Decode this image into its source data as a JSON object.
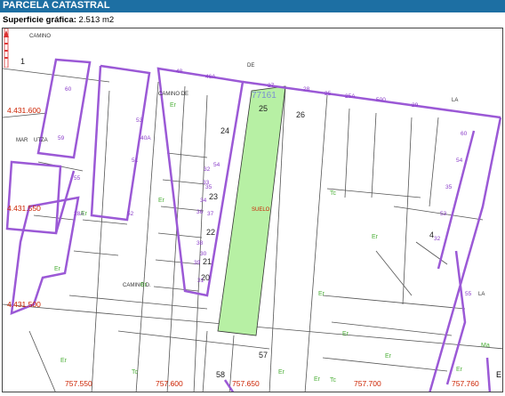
{
  "header": {
    "title": "PARCELA CATASTRAL"
  },
  "surface": {
    "label": "Superficie gráfica:",
    "value": "2.513 m2"
  },
  "map": {
    "highlight_color": "#b7f0a4",
    "parcel_border_color": "#9b59d6",
    "coord_color": "#cc2200",
    "parcel_ref": "77161",
    "parcel_number": "25",
    "parcel_class": "SUELO",
    "y_coords": [
      "4.431.600",
      "4.431.550",
      "4.431.500"
    ],
    "x_coords": [
      "757.550",
      "757.600",
      "757.650",
      "757.700",
      "757.760"
    ],
    "street_labels": [
      "CAMINO",
      "DE",
      "CAMINO DE",
      "CAMINO D.",
      "LA",
      "LA",
      "MAR",
      "UTZA",
      "E"
    ],
    "black_numbers": [
      "26",
      "24",
      "23",
      "22",
      "21",
      "20",
      "57",
      "58",
      "1",
      "4"
    ],
    "purple_numbers": [
      "48",
      "46A",
      "27",
      "28",
      "25",
      "25A",
      "500",
      "29",
      "60",
      "59",
      "55",
      "40A",
      "52",
      "51",
      "53",
      "54",
      "37",
      "35",
      "36",
      "34",
      "33",
      "32",
      "31",
      "30",
      "39",
      "38",
      "28A",
      "60",
      "54",
      "35",
      "53",
      "32",
      "55"
    ],
    "green_labels": [
      "Er",
      "Er",
      "Er",
      "Tc",
      "Er",
      "Er",
      "Er",
      "Er",
      "Er",
      "Er",
      "Tc",
      "Er",
      "Er",
      "Er",
      "Tc",
      "Er",
      "Ma"
    ]
  }
}
